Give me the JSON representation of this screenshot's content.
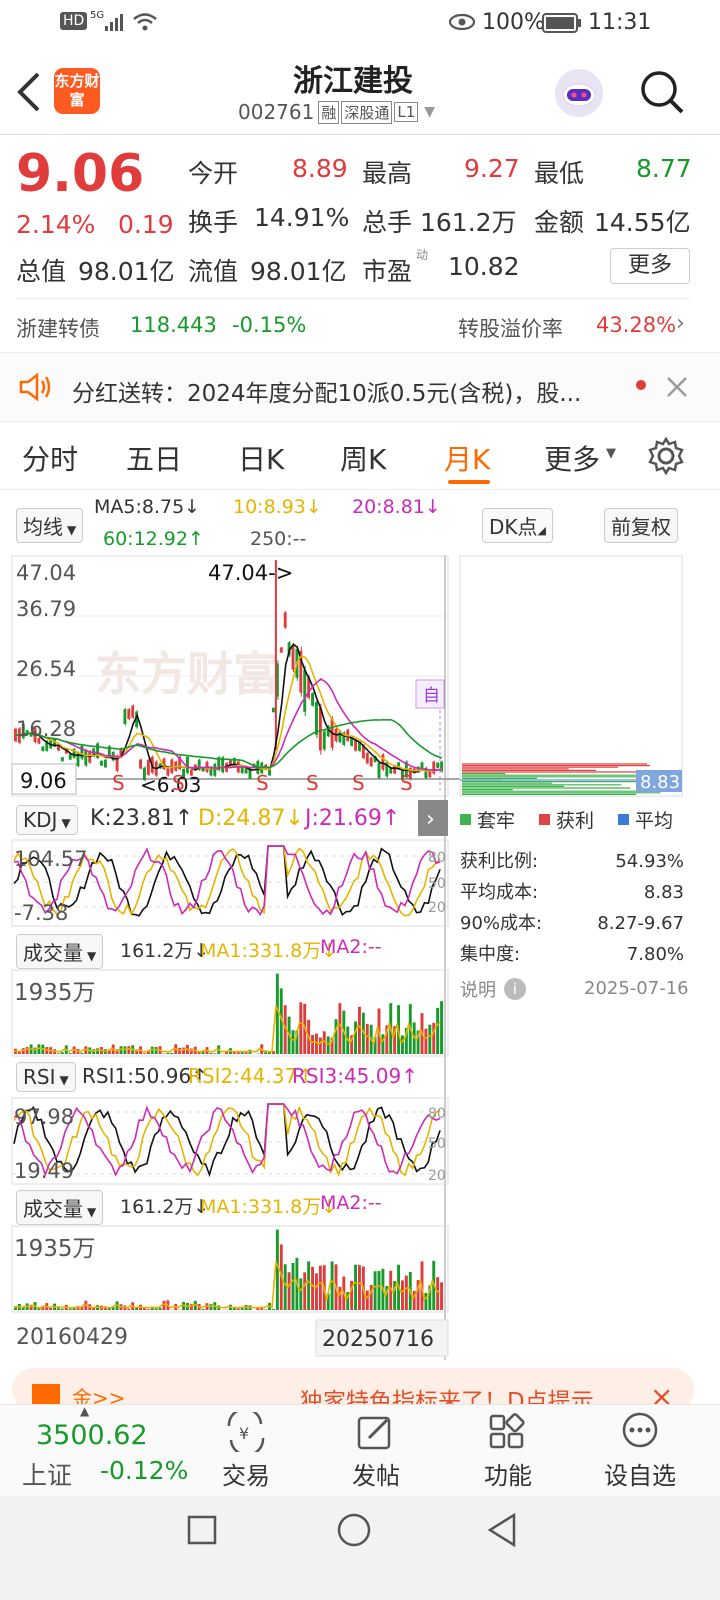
{
  "status": {
    "hd": "HD",
    "net": "5G",
    "battery": "100%",
    "time": "11:31"
  },
  "header": {
    "logo": "东方财富",
    "title": "浙江建投",
    "code": "002761",
    "tags": [
      "融",
      "深股通",
      "L1"
    ]
  },
  "quote": {
    "price": "9.06",
    "pct": "2.14%",
    "chg": "0.19",
    "open_l": "今开",
    "open": "8.89",
    "high_l": "最高",
    "high": "9.27",
    "low_l": "最低",
    "low": "8.77",
    "turn_l": "换手",
    "turn": "14.91%",
    "vol_l": "总手",
    "vol": "161.2万",
    "amt_l": "金额",
    "amt": "14.55亿",
    "mcap_l": "总值",
    "mcap": "98.01亿",
    "fcap_l": "流值",
    "fcap": "98.01亿",
    "pe_l": "市盈",
    "pe_sup": "动",
    "pe": "10.82",
    "more": "更多"
  },
  "bond": {
    "name": "浙建转债",
    "price": "118.443",
    "chg": "-0.15%",
    "prem_l": "转股溢价率",
    "prem": "43.28%"
  },
  "notice": {
    "text": "分红送转：2024年度分配10派0.5元(含税)，股..."
  },
  "tabs": [
    "分时",
    "五日",
    "日K",
    "周K",
    "月K",
    "更多"
  ],
  "ma": {
    "sel": "均线",
    "ma5": "MA5:8.75↓",
    "ma10": "10:8.93↓",
    "ma20": "20:8.81↓",
    "ma60": "60:12.92↑",
    "ma250": "250:--"
  },
  "dk": "DK点",
  "fq": "前复权",
  "main": {
    "y1": "47.04",
    "y2": "36.79",
    "y3": "26.54",
    "y4": "16.28",
    "cur": "9.06",
    "peak": "47.04->",
    "low": "<6.03",
    "zi": "自"
  },
  "kdj": {
    "sel": "KDJ",
    "k": "K:23.81↑",
    "d": "D:24.87↓",
    "j": "J:21.69↑",
    "y1": "104.57",
    "y2": "-7.38",
    "l80": "80",
    "l50": "50",
    "l20": "20"
  },
  "vol1": {
    "sel": "成交量",
    "v": "161.2万↓",
    "ma1": "MA1:331.8万↓",
    "ma2": "MA2:--",
    "y": "1935万"
  },
  "rsi": {
    "sel": "RSI",
    "r1": "RSI1:50.96↑",
    "r2": "RSI2:44.37↑",
    "r3": "RSI3:45.09↑",
    "y1": "97.98",
    "y2": "19.49",
    "l80": "80",
    "l50": "50",
    "l20": "20"
  },
  "vol2": {
    "sel": "成交量",
    "v": "161.2万↓",
    "ma1": "MA1:331.8万↓",
    "ma2": "MA2:--",
    "y": "1935万"
  },
  "dates": {
    "start": "20160429",
    "end": "20250716"
  },
  "chip": {
    "price": "8.83",
    "leg": [
      "套牢",
      "获利",
      "平均"
    ],
    "rows": [
      [
        "获利比例:",
        "54.93%"
      ],
      [
        "平均成本:",
        "8.83"
      ],
      [
        "90%成本:",
        "8.27-9.67"
      ],
      [
        "集中度:",
        "7.80%"
      ]
    ],
    "note": "说明",
    "date": "2025-07-16"
  },
  "banner": {
    "text": "独家特色指标来了！D点提示",
    "left": "金>>"
  },
  "bottom": {
    "index": "3500.62",
    "name": "上证",
    "pct": "-0.12%",
    "items": [
      "交易",
      "发帖",
      "功能",
      "设自选"
    ]
  },
  "colors": {
    "up": "#e03c3c",
    "down": "#169b2a",
    "ma10": "#e6b400",
    "ma20": "#cc2ab8",
    "accent": "#ff6a00"
  }
}
